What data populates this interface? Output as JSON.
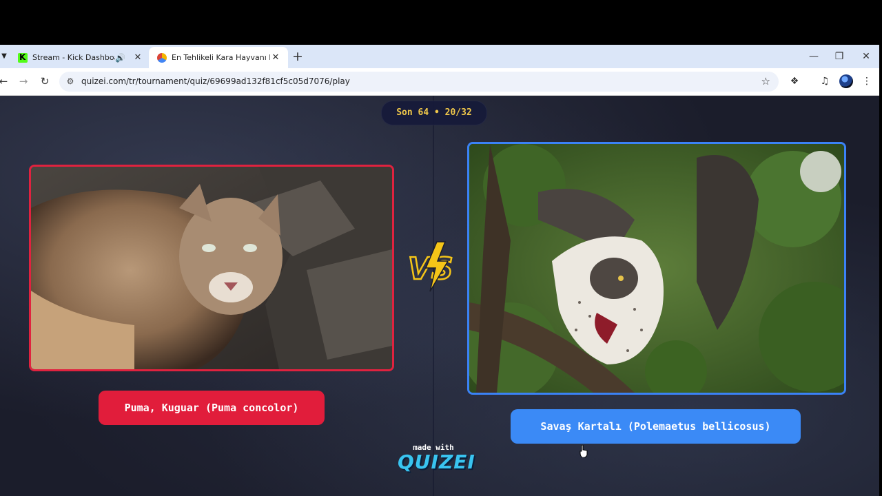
{
  "browser": {
    "tabs": [
      {
        "title": "Stream - Kick Dashboard",
        "favicon": "kick-icon",
        "audio": true
      },
      {
        "title": "En Tehlikeli Kara Hayvanı Hangi",
        "favicon": "quizei-icon",
        "active": true
      }
    ],
    "url": "quizei.com/tr/tournament/quiz/69699ad132f81cf5c05d7076/play"
  },
  "game": {
    "round_label": "Son 64 • 20/32",
    "vs_label": "VS",
    "left_choice": {
      "label": "Puma, Kuguar (Puma concolor)",
      "accent_color": "#e11d3b"
    },
    "right_choice": {
      "label": "Savaş Kartalı (Polemaetus bellicosus)",
      "accent_color": "#3b8af6"
    },
    "made_with": "made with",
    "brand": "QUIZEI"
  },
  "colors": {
    "badge_text": "#f0c84a",
    "vs_yellow": "#f5c518",
    "brand_blue": "#39c4f0"
  }
}
